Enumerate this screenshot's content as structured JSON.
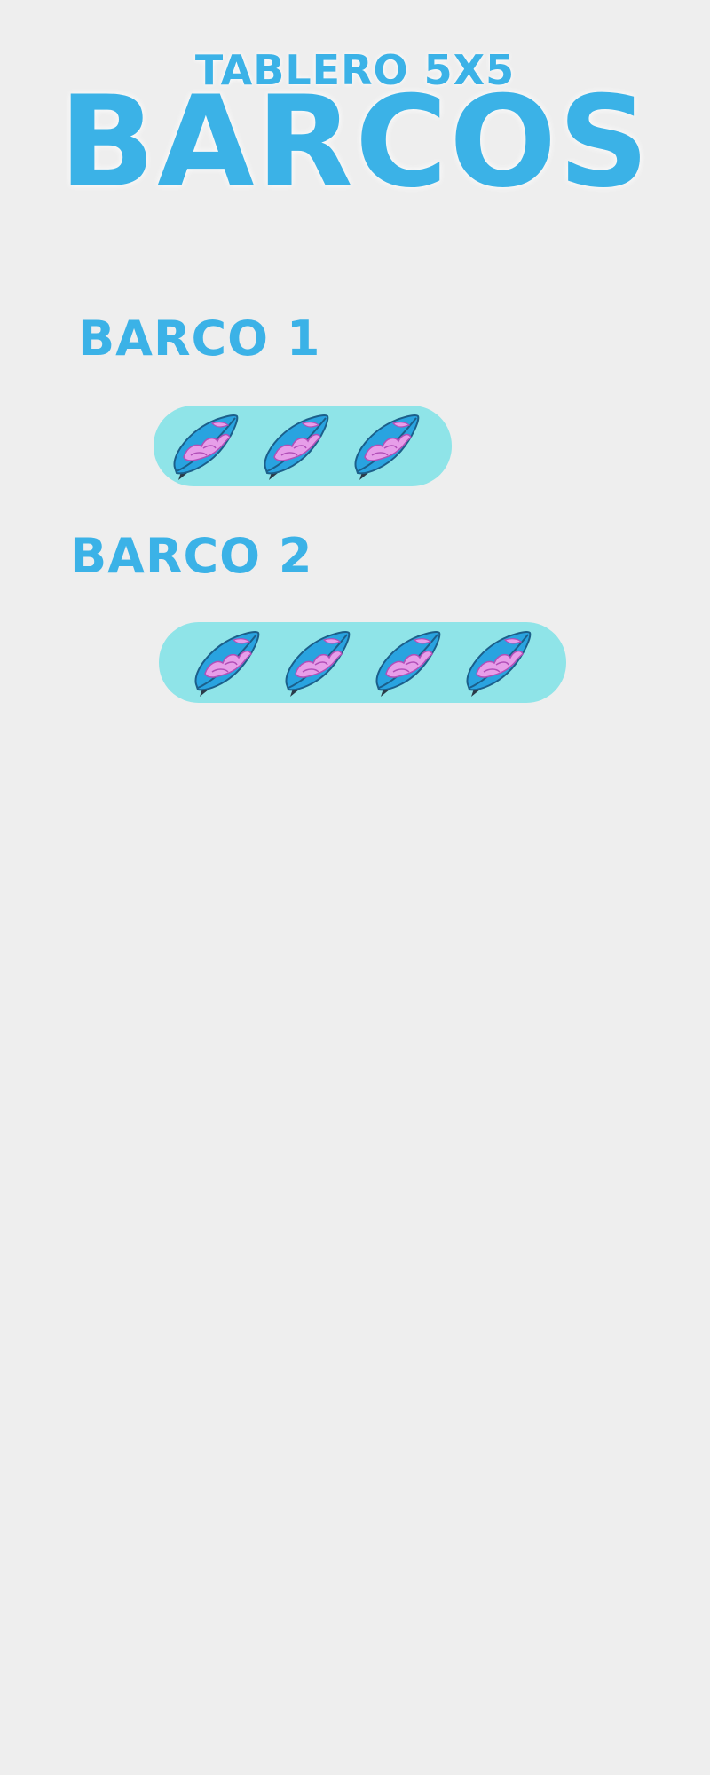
{
  "header": {
    "subtitle": "TABLERO 5X5",
    "title": "BARCOS"
  },
  "ships": [
    {
      "label": "BARCO 1",
      "cells": 3,
      "icon": "surfboard-icon"
    },
    {
      "label": "BARCO 2",
      "cells": 4,
      "icon": "surfboard-icon"
    }
  ],
  "colors": {
    "background": "#eeeeee",
    "title": "#3bb2e7",
    "ship_bar": "#8fe4e8",
    "board_blue": "#29a3e0",
    "board_pink": "#e79ee9"
  }
}
